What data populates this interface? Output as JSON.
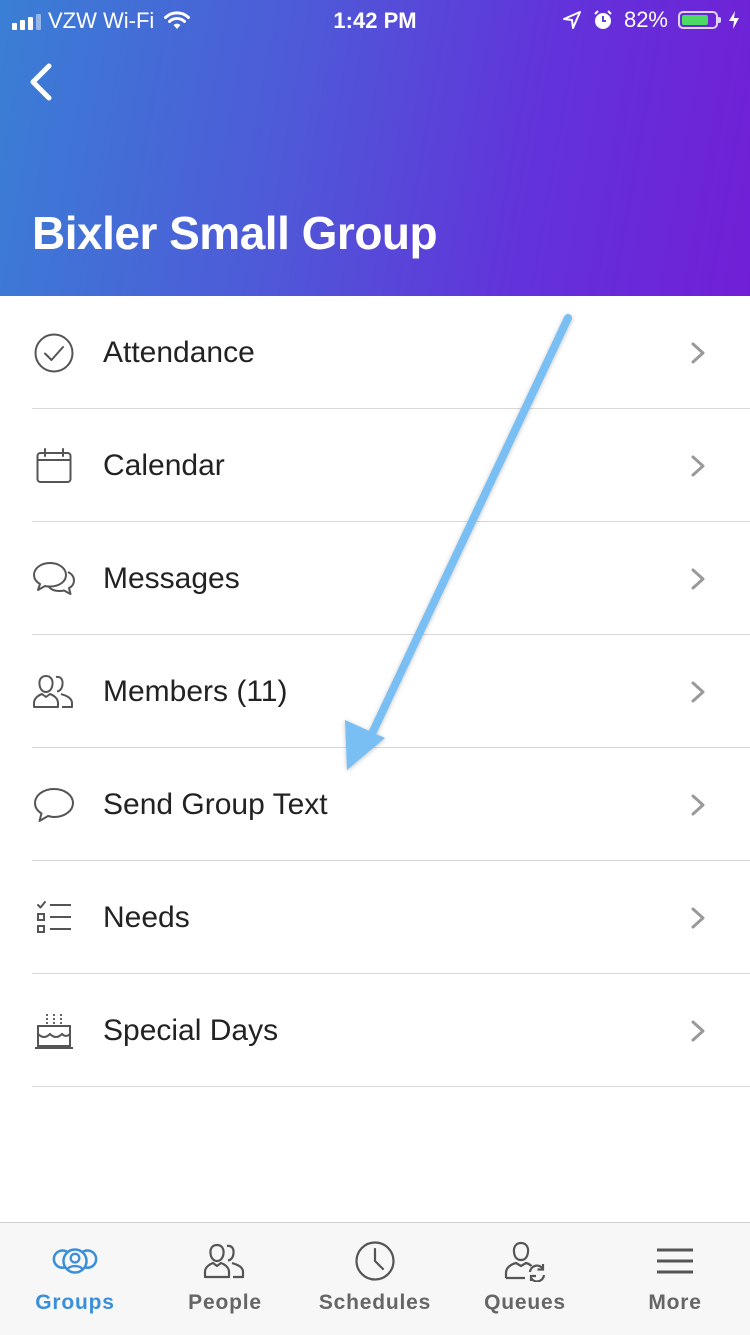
{
  "status_bar": {
    "carrier": "VZW Wi-Fi",
    "time": "1:42 PM",
    "battery_percent": "82%",
    "battery_level": 0.82
  },
  "header": {
    "title": "Bixler Small Group"
  },
  "menu": {
    "items": [
      {
        "label": "Attendance",
        "icon": "check-circle-icon"
      },
      {
        "label": "Calendar",
        "icon": "calendar-icon"
      },
      {
        "label": "Messages",
        "icon": "chat-bubbles-icon"
      },
      {
        "label": "Members (11)",
        "icon": "members-icon"
      },
      {
        "label": "Send Group Text",
        "icon": "speech-bubble-icon"
      },
      {
        "label": "Needs",
        "icon": "checklist-icon"
      },
      {
        "label": "Special Days",
        "icon": "birthday-cake-icon"
      }
    ]
  },
  "tab_bar": {
    "tabs": [
      {
        "label": "Groups",
        "icon": "groups-icon",
        "active": true
      },
      {
        "label": "People",
        "icon": "people-icon",
        "active": false
      },
      {
        "label": "Schedules",
        "icon": "clock-icon",
        "active": false
      },
      {
        "label": "Queues",
        "icon": "queue-person-icon",
        "active": false
      },
      {
        "label": "More",
        "icon": "hamburger-menu-icon",
        "active": false
      }
    ]
  },
  "colors": {
    "header_gradient_start": "#3a7fd5",
    "header_gradient_end": "#711fd6",
    "active_tab": "#3a8fd8",
    "annotation_arrow": "#79bff4"
  }
}
